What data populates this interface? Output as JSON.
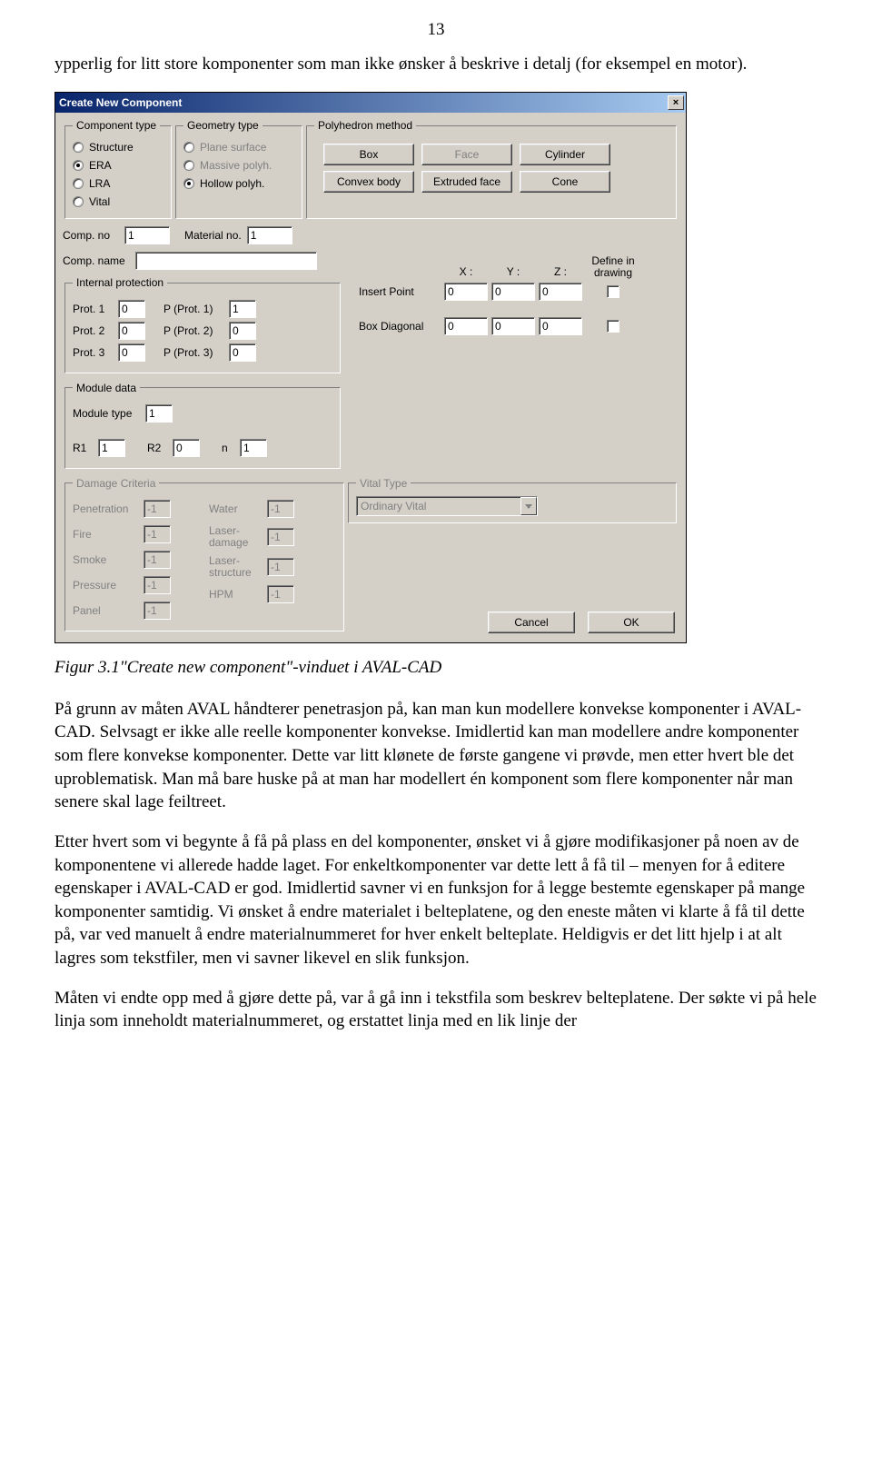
{
  "page_number": "13",
  "paragraph_intro": "ypperlig for litt store komponenter som man ikke ønsker å beskrive i detalj (for eksempel en motor).",
  "caption": "Figur 3.1\"Create new component\"-vinduet i AVAL-CAD",
  "paragraph_1": "På grunn av måten AVAL håndterer penetrasjon på, kan man kun modellere konvekse komponenter i AVAL-CAD. Selvsagt er ikke alle reelle komponenter konvekse. Imidlertid kan man modellere andre komponenter som flere konvekse komponenter. Dette var litt klønete de første gangene vi prøvde, men etter hvert ble det uproblematisk. Man må bare huske på at man har modellert én komponent som flere komponenter når man senere skal lage feiltreet.",
  "paragraph_2": "Etter hvert som vi begynte å få på plass en del komponenter, ønsket vi å gjøre modifikasjoner på noen av de komponentene vi allerede hadde laget. For enkeltkomponenter var dette lett å få til – menyen for å editere egenskaper i AVAL-CAD er god. Imidlertid savner vi en funksjon for å legge bestemte egenskaper på mange komponenter samtidig. Vi ønsket å endre materialet i belteplatene, og den eneste måten vi klarte å få til dette på, var ved manuelt å endre materialnummeret for hver enkelt belteplate. Heldigvis er det litt hjelp i at alt lagres som tekstfiler, men vi savner likevel en slik funksjon.",
  "paragraph_3": "Måten vi endte opp med å gjøre dette på, var å gå inn i tekstfila som beskrev belteplatene. Der søkte vi på hele linja som inneholdt materialnummeret, og erstattet linja med en lik linje der",
  "dialog": {
    "title": "Create New Component",
    "groups": {
      "component_type": {
        "legend": "Component type",
        "options": [
          "Structure",
          "ERA",
          "LRA",
          "Vital"
        ],
        "selected": "ERA"
      },
      "geometry_type": {
        "legend": "Geometry type",
        "options": [
          "Plane surface",
          "Massive polyh.",
          "Hollow polyh."
        ],
        "selected": "Hollow polyh."
      },
      "poly_method": {
        "legend": "Polyhedron method",
        "buttons": [
          "Box",
          "Face",
          "Cylinder",
          "Convex body",
          "Extruded face",
          "Cone"
        ]
      },
      "internal_protection": {
        "legend": "Internal protection",
        "rows": [
          {
            "l1": "Prot. 1",
            "v1": "0",
            "l2": "P (Prot. 1)",
            "v2": "1"
          },
          {
            "l1": "Prot. 2",
            "v1": "0",
            "l2": "P (Prot. 2)",
            "v2": "0"
          },
          {
            "l1": "Prot. 3",
            "v1": "0",
            "l2": "P (Prot. 3)",
            "v2": "0"
          }
        ]
      },
      "module_data": {
        "legend": "Module data",
        "module_type_label": "Module type",
        "module_type": "1",
        "r1_label": "R1",
        "r1": "1",
        "r2_label": "R2",
        "r2": "0",
        "n_label": "n",
        "n": "1"
      },
      "damage": {
        "legend": "Damage Criteria",
        "rows": [
          {
            "l": "Penetration",
            "v": "-1"
          },
          {
            "l": "Fire",
            "v": "-1"
          },
          {
            "l": "Smoke",
            "v": "-1"
          },
          {
            "l": "Pressure",
            "v": "-1"
          },
          {
            "l": "Panel",
            "v": "-1"
          }
        ],
        "rows2": [
          {
            "l": "Water",
            "v": "-1"
          },
          {
            "l": "Laser-\ndamage",
            "v": "-1"
          },
          {
            "l": "Laser-\nstructure",
            "v": "-1"
          },
          {
            "l": "HPM",
            "v": "-1"
          }
        ]
      },
      "vital": {
        "legend": "Vital Type",
        "selected": "Ordinary Vital"
      }
    },
    "misc": {
      "comp_no_label": "Comp. no",
      "comp_no": "1",
      "material_no_label": "Material no.",
      "material_no": "1",
      "comp_name_label": "Comp. name",
      "comp_name": "",
      "x_label": "X :",
      "y_label": "Y :",
      "z_label": "Z :",
      "define_label": "Define in\ndrawing",
      "insert_label": "Insert Point",
      "insert": {
        "x": "0",
        "y": "0",
        "z": "0"
      },
      "boxdiag_label": "Box Diagonal",
      "boxdiag": {
        "x": "0",
        "y": "0",
        "z": "0"
      }
    },
    "buttons": {
      "cancel": "Cancel",
      "ok": "OK"
    }
  }
}
